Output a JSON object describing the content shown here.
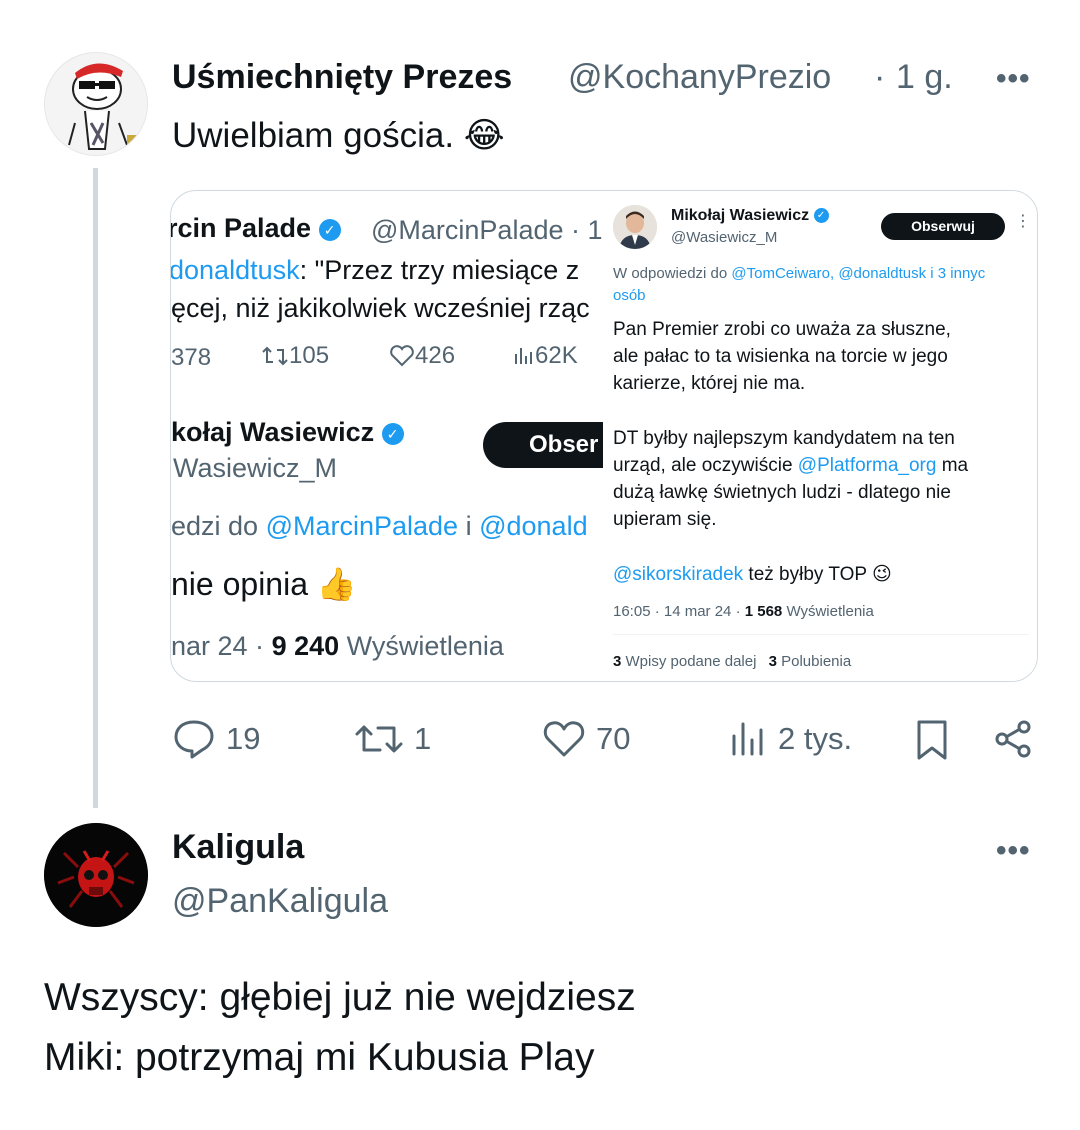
{
  "reply": {
    "name": "Uśmiechnięty Prezes",
    "handle": "@KochanyPrezio",
    "separator": "·",
    "time": "1 g.",
    "more_label": "•••",
    "text": "Uwielbiam gościa.",
    "emoji": "😂",
    "media": {
      "left": {
        "author_name": "rcin Palade",
        "author_handle": "@MarcinPalade · 1",
        "quote_line1_mention": "donaldtusk",
        "quote_line1_rest": ": \"Przez trzy miesiące z",
        "quote_line2": "ęcej, niż jakikolwiek wcześniej rząc",
        "stat_replies": "378",
        "stat_reposts": "105",
        "stat_likes": "426",
        "stat_views": "62K",
        "author2_name": "kołaj Wasiewicz",
        "author2_handle": "Wasiewicz_M",
        "follow_label": "Obser",
        "reply_prefix": "edzi do ",
        "reply_mention1": "@MarcinPalade",
        "reply_and": " i ",
        "reply_mention2": "@donald",
        "body": "nie opinia",
        "body_emoji": "👍",
        "date": "nar 24 · ",
        "views_count": "9 240",
        "views_label": " Wyświetlenia"
      },
      "right": {
        "author_name": "Mikołaj Wasiewicz",
        "author_handle": "@Wasiewicz_M",
        "follow_label": "Obserwuj",
        "reply_to_prefix": "W odpowiedzi do ",
        "reply_to_mentions": "@TomCeiwaro, @donaldtusk i 3 innyc",
        "reply_to_suffix": "osób",
        "para1_line1": "Pan Premier zrobi co uważa za słuszne,",
        "para1_line2": "ale pałac to ta wisienka na torcie w jego",
        "para1_line3": "karierze, której nie ma.",
        "para2_line1": "DT byłby najlepszym kandydatem na ten",
        "para2_line2_a": "urząd, ale oczywiście ",
        "para2_line2_mention": "@Platforma_org",
        "para2_line2_b": " ma",
        "para2_line3": "dużą ławkę świetnych ludzi - dlatego nie",
        "para2_line4": "upieram się.",
        "para3_mention": "@sikorskiradek",
        "para3_rest": " też byłby TOP",
        "para3_emoji": "😉",
        "timestamp": "16:05 · 14 mar 24 · ",
        "views_count": "1 568",
        "views_label": " Wyświetlenia",
        "reposts_count": "3",
        "reposts_label": " Wpisy podane dalej",
        "likes_count": "3",
        "likes_label": " Polubienia"
      }
    },
    "actions": {
      "replies": "19",
      "reposts": "1",
      "likes": "70",
      "views": "2 tys."
    }
  },
  "post": {
    "name": "Kaligula",
    "handle": "@PanKaligula",
    "more_label": "•••",
    "line1": "Wszyscy: głębiej już nie wejdziesz",
    "line2": "Miki: potrzymaj mi Kubusia Play"
  },
  "colors": {
    "accent": "#1d9bf0",
    "text": "#0f1419",
    "muted": "#536471",
    "thread_line": "#cfd9de"
  }
}
